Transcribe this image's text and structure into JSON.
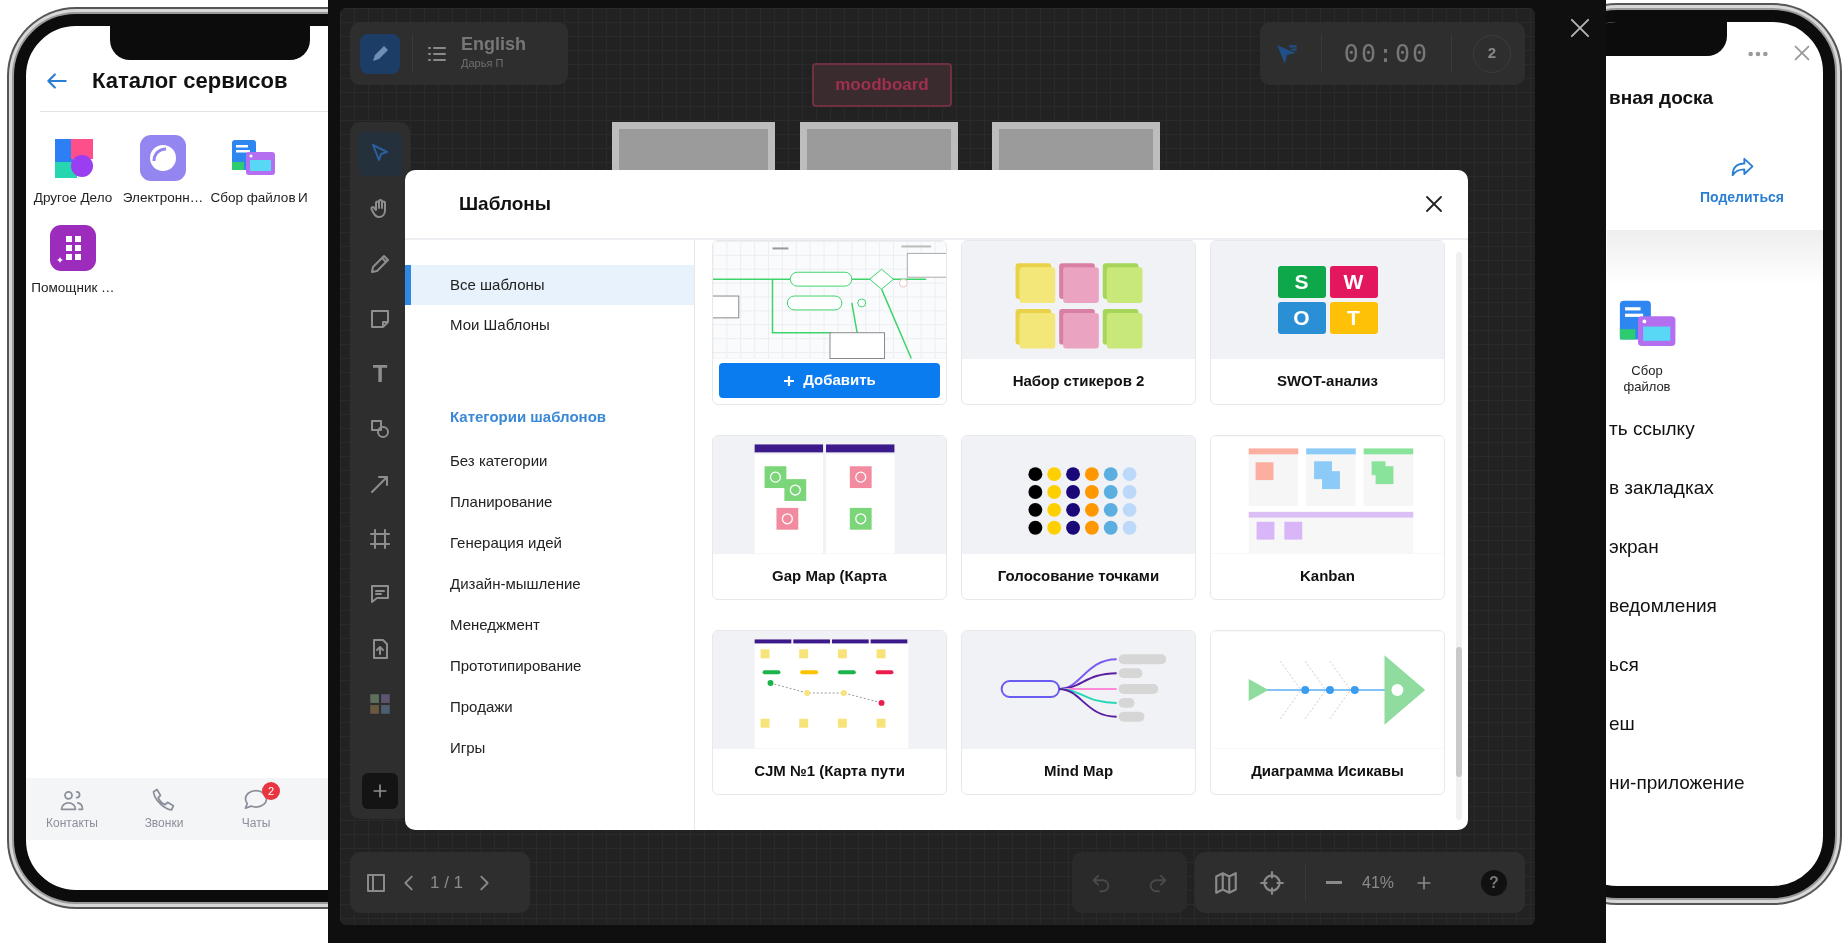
{
  "left_phone": {
    "title": "Каталог сервисов",
    "apps": [
      {
        "label": "Другое Дело",
        "kind": "shapes"
      },
      {
        "label": "Электронн…",
        "kind": "orb"
      },
      {
        "label": "Сбор файлов",
        "kind": "files"
      },
      {
        "label": "И",
        "kind": "covered"
      },
      {
        "label": "Помощник …",
        "kind": "grid"
      }
    ],
    "tabs": [
      {
        "label": "Контакты",
        "kind": "contacts",
        "selected": false
      },
      {
        "label": "Звонки",
        "kind": "calls",
        "selected": false
      },
      {
        "label": "Чаты",
        "kind": "chats",
        "selected": false,
        "badge": "2"
      }
    ]
  },
  "board": {
    "title": "English",
    "subtitle": "Дарья П",
    "sticker": "moodboard",
    "timer": "00:00",
    "participants": "2",
    "tools": [
      {
        "kind": "pointer",
        "selected": true
      },
      {
        "kind": "hand",
        "selected": false
      },
      {
        "kind": "pencil",
        "selected": false
      },
      {
        "kind": "note",
        "selected": false
      },
      {
        "kind": "text",
        "label": "T",
        "selected": false
      },
      {
        "kind": "shapes",
        "selected": false
      },
      {
        "kind": "arrow",
        "selected": false
      },
      {
        "kind": "frame",
        "selected": false
      },
      {
        "kind": "comment",
        "selected": false
      },
      {
        "kind": "upload",
        "selected": false
      },
      {
        "kind": "templates",
        "selected": false
      },
      {
        "kind": "add",
        "selected": false
      }
    ],
    "pager": "1 / 1",
    "undo": {
      "disabled": true
    },
    "redo": {
      "disabled": true
    },
    "zoom": "41%",
    "help": "?"
  },
  "modal": {
    "title": "Шаблоны",
    "nav": [
      {
        "label": "Все шаблоны",
        "selected": true
      },
      {
        "label": "Мои Шаблоны",
        "selected": false
      }
    ],
    "categories_heading": "Категории шаблонов",
    "categories": [
      "Без категории",
      "Планирование",
      "Генерация идей",
      "Дизайн-мышление",
      "Менеджмент",
      "Прототипирование",
      "Продажи",
      "Игры"
    ],
    "templates": [
      {
        "kind": "flowchart",
        "action": "Добавить"
      },
      {
        "kind": "stickers",
        "title": "Набор стикеров 2"
      },
      {
        "kind": "swot",
        "title": "SWOT-анализ",
        "letters": [
          "S",
          "W",
          "O",
          "T"
        ]
      },
      {
        "kind": "gapmap",
        "title": "Gap Map (Карта"
      },
      {
        "kind": "dots",
        "title": "Голосование точками"
      },
      {
        "kind": "kanban",
        "title": "Kanban"
      },
      {
        "kind": "cjm",
        "title": "CJM №1 (Карта пути"
      },
      {
        "kind": "mindmap",
        "title": "Mind Map"
      },
      {
        "kind": "fishbone",
        "title": "Диаграмма Исикавы"
      }
    ]
  },
  "right_phone": {
    "title": "вная доска",
    "share": "Поделиться",
    "app": {
      "kind": "files",
      "label": "Сбор файлов"
    },
    "menu": [
      "ть ссылку",
      "в закладках",
      "экран",
      "ведомления",
      "ься",
      "еш",
      "ни-приложение"
    ]
  }
}
